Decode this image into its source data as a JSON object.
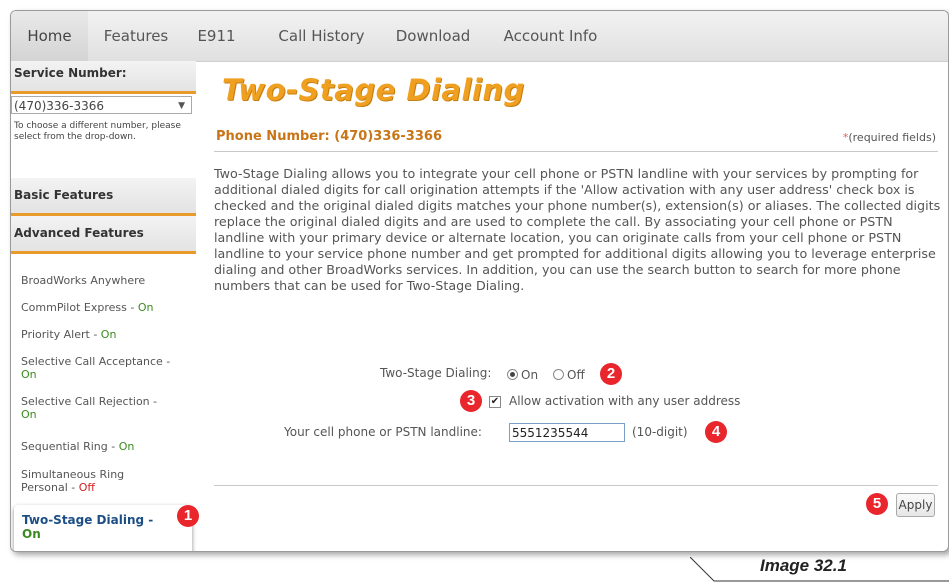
{
  "nav": {
    "tabs": [
      {
        "label": "Home"
      },
      {
        "label": "Features"
      },
      {
        "label": "E911"
      },
      {
        "label": "Call History"
      },
      {
        "label": "Download"
      },
      {
        "label": "Account Info"
      }
    ],
    "active": "Home"
  },
  "sidebar": {
    "service_number_heading": "Service Number:",
    "service_number_value": "(470)336-3366",
    "help_text": "To choose a different number, please select from the drop-down.",
    "basic_features_heading": "Basic Features",
    "advanced_features_heading": "Advanced Features",
    "features": [
      {
        "name": "BroadWorks Anywhere",
        "status": ""
      },
      {
        "name": "CommPilot Express - ",
        "status": "On"
      },
      {
        "name": "Priority Alert - ",
        "status": "On"
      },
      {
        "name": "Selective Call Acceptance - ",
        "status": "On"
      },
      {
        "name": "Selective Call Rejection - ",
        "status": "On"
      },
      {
        "name": "Sequential Ring - ",
        "status": "On"
      },
      {
        "name": "Simultaneous Ring Personal - ",
        "status": "Off"
      }
    ],
    "active_feature": {
      "name": "Two-Stage Dialing - ",
      "status": "On"
    }
  },
  "main": {
    "title": "Two-Stage Dialing",
    "phone_label": "Phone Number: (470)336-3366",
    "required_star": "*",
    "required_text": "(required fields)",
    "description": "Two-Stage Dialing allows you to integrate your cell phone or PSTN landline with your services by prompting for additional dialed digits for call origination attempts if the 'Allow activation with any user address' check box is checked and the original dialed digits matches your phone number(s), extension(s) or aliases. The collected digits replace the original dialed digits and are used to complete the call. By associating your cell phone or PSTN landline with your primary device or alternate location, you can originate calls from your cell phone or PSTN landline to your service phone number and get prompted for additional digits allowing you to leverage enterprise dialing and other BroadWorks services. In addition, you can use the search button to search for more phone numbers that can be used for Two-Stage Dialing.",
    "two_stage_label": "Two-Stage Dialing:",
    "on_label": "On",
    "off_label": "Off",
    "two_stage_value": "On",
    "allow_activation_label": "Allow activation with any user address",
    "allow_activation_checked": true,
    "cell_label": "Your cell phone or PSTN landline:",
    "cell_value": "5551235544",
    "cell_hint": "(10-digit)",
    "apply_label": "Apply"
  },
  "callouts": [
    "1",
    "2",
    "3",
    "4",
    "5"
  ],
  "caption": "Image 32.1",
  "colors": {
    "accent_orange": "#f0a020",
    "phone_label": "#c87518",
    "on_green": "#3a8a1f",
    "off_red": "#cc2222",
    "callout_red": "#e8262c",
    "active_blue": "#1d4f86"
  }
}
